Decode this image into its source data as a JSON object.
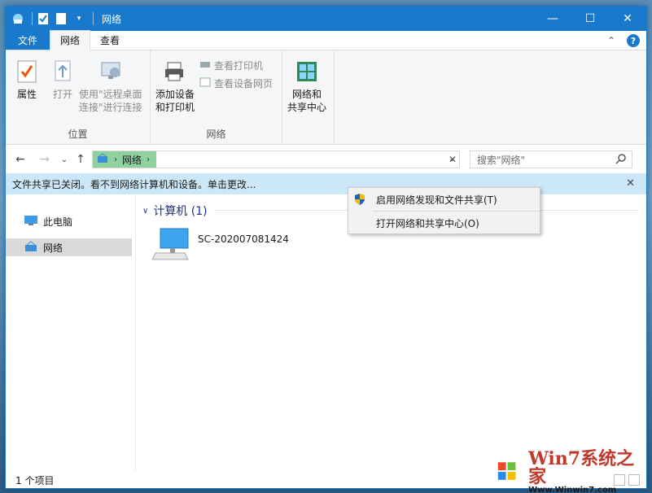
{
  "window": {
    "title": "网络"
  },
  "titlebar": {
    "minimize": "—",
    "maximize": "☐",
    "close": "✕"
  },
  "tabs": {
    "file": "文件",
    "network": "网络",
    "view": "查看",
    "expand_icon": "⌃",
    "help": "?"
  },
  "ribbon": {
    "location_group": {
      "label": "位置",
      "properties": "属性",
      "open": "打开",
      "remote_desktop_line1": "使用\"远程桌面",
      "remote_desktop_line2": "连接\"进行连接"
    },
    "network_group": {
      "label": "网络",
      "add_device_line1": "添加设备",
      "add_device_line2": "和打印机",
      "view_printers": "查看打印机",
      "view_device_page": "查看设备网页"
    },
    "share_group": {
      "line1": "网络和",
      "line2": "共享中心"
    }
  },
  "address": {
    "crumb": "网络",
    "search_placeholder": "搜索\"网络\""
  },
  "infobar": {
    "text": "文件共享已关闭。看不到网络计算机和设备。单击更改...",
    "close": "✕"
  },
  "navpane": {
    "items": [
      {
        "label": "此电脑"
      },
      {
        "label": "网络"
      }
    ]
  },
  "content": {
    "group_header": "计算机 (1)",
    "computer_name": "SC-202007081424"
  },
  "context_menu": {
    "items": [
      {
        "label": "启用网络发现和文件共享(T)"
      },
      {
        "label": "打开网络和共享中心(O)"
      }
    ]
  },
  "statusbar": {
    "text": "1 个项目"
  },
  "watermark": {
    "brand": "Win7系统之家",
    "url": "Www.Winwin7.com"
  },
  "colors": {
    "accent": "#1979ca",
    "infobar": "#cce8f8",
    "crumb": "#8fd19e",
    "nav_selected": "#d9d9d9",
    "group_header": "#1e3287"
  }
}
